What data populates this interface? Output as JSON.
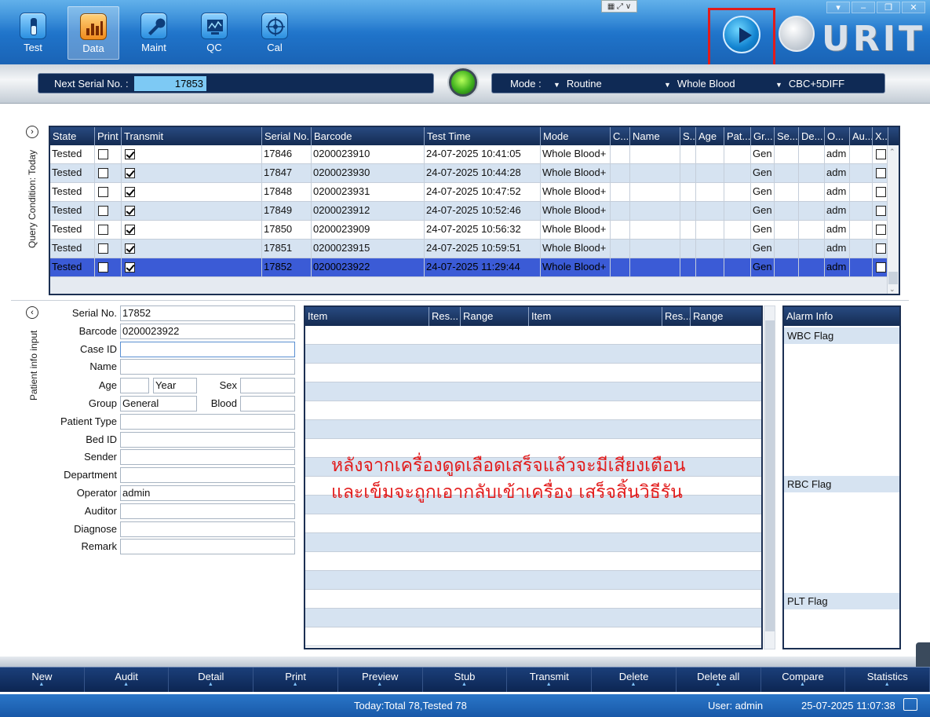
{
  "toolbar": {
    "buttons": [
      {
        "label": "Test",
        "icon": "test-tube-icon"
      },
      {
        "label": "Data",
        "icon": "bar-chart-icon"
      },
      {
        "label": "Maint",
        "icon": "wrench-icon"
      },
      {
        "label": "QC",
        "icon": "qc-monitor-icon"
      },
      {
        "label": "Cal",
        "icon": "calibration-target-icon"
      }
    ],
    "active": "Data",
    "logo": "URIT"
  },
  "info_bar": {
    "serial_label": "Next Serial No. :",
    "serial_value": "17853",
    "mode_label": "Mode :",
    "mode_1": "Routine",
    "mode_2": "Whole Blood",
    "mode_3": "CBC+5DIFF"
  },
  "query_section": {
    "side_label": "Query Condition: Today",
    "columns": [
      "State",
      "Print",
      "Transmit",
      "Serial No.",
      "Barcode",
      "Test Time",
      "Mode",
      "C...",
      "Name",
      "S...",
      "Age",
      "Pat...",
      "Gr...",
      "Se...",
      "De...",
      "O...",
      "Au...",
      "X..."
    ],
    "rows": [
      {
        "state": "Tested",
        "print": false,
        "transmit": true,
        "serial": "17846",
        "barcode": "0200023910",
        "time": "24-07-2025  10:41:05",
        "mode": "Whole Blood+",
        "group": "Gen",
        "operator": "adm"
      },
      {
        "state": "Tested",
        "print": false,
        "transmit": true,
        "serial": "17847",
        "barcode": "0200023930",
        "time": "24-07-2025  10:44:28",
        "mode": "Whole Blood+",
        "group": "Gen",
        "operator": "adm"
      },
      {
        "state": "Tested",
        "print": false,
        "transmit": true,
        "serial": "17848",
        "barcode": "0200023931",
        "time": "24-07-2025  10:47:52",
        "mode": "Whole Blood+",
        "group": "Gen",
        "operator": "adm"
      },
      {
        "state": "Tested",
        "print": false,
        "transmit": true,
        "serial": "17849",
        "barcode": "0200023912",
        "time": "24-07-2025  10:52:46",
        "mode": "Whole Blood+",
        "group": "Gen",
        "operator": "adm"
      },
      {
        "state": "Tested",
        "print": false,
        "transmit": true,
        "serial": "17850",
        "barcode": "0200023909",
        "time": "24-07-2025  10:56:32",
        "mode": "Whole Blood+",
        "group": "Gen",
        "operator": "adm"
      },
      {
        "state": "Tested",
        "print": false,
        "transmit": true,
        "serial": "17851",
        "barcode": "0200023915",
        "time": "24-07-2025  10:59:51",
        "mode": "Whole Blood+",
        "group": "Gen",
        "operator": "adm"
      },
      {
        "state": "Tested",
        "print": false,
        "transmit": true,
        "serial": "17852",
        "barcode": "0200023922",
        "time": "24-07-2025  11:29:44",
        "mode": "Whole Blood+",
        "group": "Gen",
        "operator": "adm"
      }
    ],
    "selected_row": 6
  },
  "patient": {
    "side_label": "Patient info input",
    "serial_label": "Serial No.",
    "serial_value": "17852",
    "barcode_label": "Barcode",
    "barcode_value": "0200023922",
    "caseid_label": "Case ID",
    "name_label": "Name",
    "age_label": "Age",
    "age_unit": "Year",
    "sex_label": "Sex",
    "group_label": "Group",
    "group_value": "General",
    "blood_label": "Blood",
    "ptype_label": "Patient Type",
    "bed_label": "Bed ID",
    "sender_label": "Sender",
    "dept_label": "Department",
    "operator_label": "Operator",
    "operator_value": "admin",
    "auditor_label": "Auditor",
    "diagnose_label": "Diagnose",
    "remark_label": "Remark"
  },
  "results": {
    "columns": [
      "Item",
      "Res...",
      "Range",
      "Item",
      "Res...",
      "Range"
    ]
  },
  "annotation": {
    "line1": "หลังจากเครื่องดูดเลือดเสร็จแล้วจะมีเสียงเตือน",
    "line2": "และเข็มจะถูกเอากลับเข้าเครื่อง เสร็จสิ้นวิธีรัน",
    "color": "#e21b1b"
  },
  "alarm": {
    "title": "Alarm Info",
    "wbc": "WBC Flag",
    "rbc": "RBC Flag",
    "plt": "PLT Flag"
  },
  "bottom_buttons": [
    "New",
    "Audit",
    "Detail",
    "Print",
    "Preview",
    "Stub",
    "Transmit",
    "Delete",
    "Delete all",
    "Compare",
    "Statistics"
  ],
  "status": {
    "summary": "Today:Total 78,Tested 78",
    "user": "User: admin",
    "datetime": "25-07-2025  11:07:38"
  }
}
